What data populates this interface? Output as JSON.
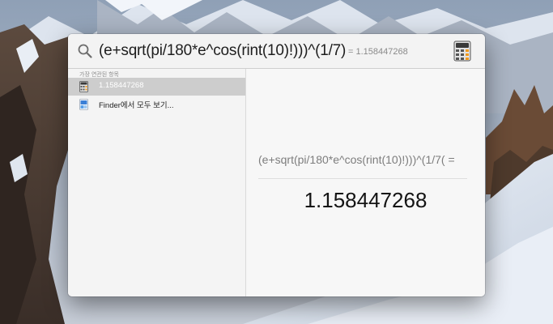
{
  "spotlight": {
    "query": "(e+sqrt(pi/180*e^cos(rint(10)!)))^(1/7)",
    "inline_result": "= 1.158447268",
    "section_header": "가장 연관된 항목",
    "results": [
      {
        "label": "1.158447268",
        "icon": "calculator-icon",
        "selected": true
      },
      {
        "label": "Finder에서 모두 보기...",
        "icon": "finder-icon",
        "selected": false
      }
    ],
    "preview": {
      "expression": "(e+sqrt(pi/180*e^cos(rint(10)!)))^(1/7( =",
      "result": "1.158447268"
    }
  },
  "colors": {
    "selection": "#cdcdcd",
    "panel": "#f0f0f0"
  }
}
